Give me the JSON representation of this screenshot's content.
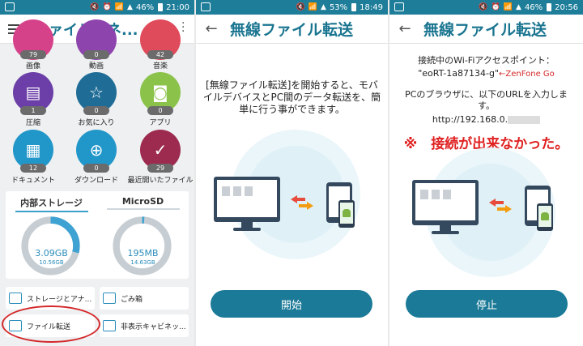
{
  "status": {
    "p1_battery": "46%",
    "p1_time": "21:00",
    "p2_battery": "53%",
    "p2_time": "18:49",
    "p3_battery": "46%",
    "p3_time": "20:56"
  },
  "file_manager": {
    "title": "ファイルマネ...",
    "top_categories": [
      {
        "count": "79",
        "label": "画像",
        "color": "#d6428a"
      },
      {
        "count": "0",
        "label": "動画",
        "color": "#8e44ad"
      },
      {
        "count": "42",
        "label": "音楽",
        "color": "#e04b5c"
      }
    ],
    "categories": [
      {
        "count": "1",
        "label": "圧縮",
        "color": "#6c3fa8",
        "icon": "archive-icon"
      },
      {
        "count": "0",
        "label": "お気に入り",
        "color": "#1f6d96",
        "icon": "star-icon"
      },
      {
        "count": "0",
        "label": "アプリ",
        "color": "#8bc34a",
        "icon": "android-icon"
      },
      {
        "count": "12",
        "label": "ドキュメント",
        "color": "#2196c9",
        "icon": "document-icon"
      },
      {
        "count": "0",
        "label": "ダウンロード",
        "color": "#2196c9",
        "icon": "download-icon"
      },
      {
        "count": "29",
        "label": "最近開いたファイル",
        "color": "#9c2b4f",
        "icon": "recent-check-icon"
      }
    ],
    "storage": [
      {
        "title": "内部ストレージ",
        "used": "3.09GB",
        "total": "10.56GB",
        "fraction": 0.29
      },
      {
        "title": "MicroSD",
        "used": "195MB",
        "total": "14.63GB",
        "fraction": 0.013
      }
    ],
    "tools": {
      "storage_analyzer": "ストレージとアナ...",
      "trash": "ごみ箱",
      "file_transfer": "ファイル転送",
      "hidden_cabinet": "非表示キャビネッ..."
    }
  },
  "wifi_transfer": {
    "title": "無線ファイル転送",
    "description": "[無線ファイル転送]を開始すると、モバイルデバイスとPC間のデータ転送を、簡単に行う事ができます。",
    "start_button": "開始"
  },
  "wifi_connected": {
    "title": "無線ファイル転送",
    "ap_label": "接続中のWi-Fiアクセスポイント：",
    "ssid": "\"eoRT-1a87134-g\"",
    "ssid_note": "←ZenFone Go",
    "pc_instruction": "PCのブラウザに、以下のURLを入力します。",
    "url": "http://192.168.0.",
    "failure_note": "※　接続が出来なかった。",
    "stop_button": "停止"
  }
}
